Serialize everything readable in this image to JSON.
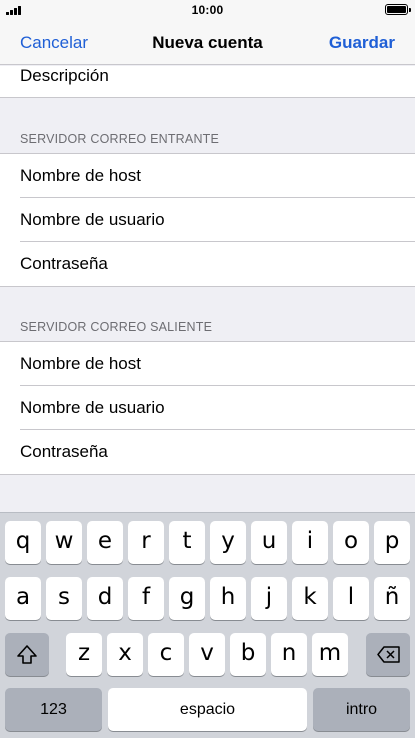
{
  "status": {
    "time": "10:00"
  },
  "nav": {
    "cancel": "Cancelar",
    "title": "Nueva cuenta",
    "save": "Guardar"
  },
  "form": {
    "description": "Descripción",
    "incoming": {
      "header": "SERVIDOR CORREO ENTRANTE",
      "host": "Nombre de host",
      "user": "Nombre de usuario",
      "password": "Contraseña"
    },
    "outgoing": {
      "header": "SERVIDOR CORREO SALIENTE",
      "host": "Nombre de host",
      "user": "Nombre de usuario",
      "password": "Contraseña"
    }
  },
  "keyboard": {
    "row1": [
      "q",
      "w",
      "e",
      "r",
      "t",
      "y",
      "u",
      "i",
      "o",
      "p"
    ],
    "row2": [
      "a",
      "s",
      "d",
      "f",
      "g",
      "h",
      "j",
      "k",
      "l",
      "ñ"
    ],
    "row3": [
      "z",
      "x",
      "c",
      "v",
      "b",
      "n",
      "m"
    ],
    "numbers": "123",
    "space": "espacio",
    "return": "intro"
  }
}
